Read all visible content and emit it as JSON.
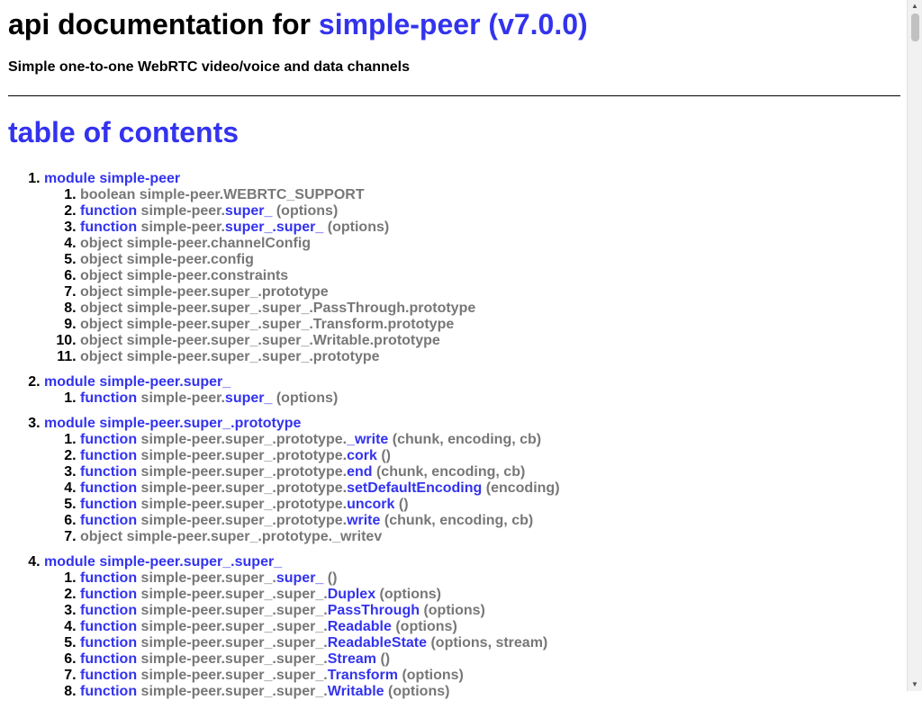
{
  "header": {
    "title_prefix": "api documentation for",
    "project": "simple-peer (v7.0.0)",
    "subtitle": "Simple one-to-one WebRTC video/voice and data channels"
  },
  "toc": {
    "heading": "table of contents",
    "modules": [
      {
        "label": "module simple-peer",
        "members": [
          {
            "kind": "boolean",
            "path": "simple-peer.WEBRTC_SUPPORT",
            "link": "",
            "args": ""
          },
          {
            "kind": "function",
            "path": "simple-peer.",
            "link": "super_",
            "args": "(options)"
          },
          {
            "kind": "function",
            "path": "simple-peer.",
            "link": "super_.super_",
            "args": "(options)"
          },
          {
            "kind": "object",
            "path": "simple-peer.channelConfig",
            "link": "",
            "args": ""
          },
          {
            "kind": "object",
            "path": "simple-peer.config",
            "link": "",
            "args": ""
          },
          {
            "kind": "object",
            "path": "simple-peer.constraints",
            "link": "",
            "args": ""
          },
          {
            "kind": "object",
            "path": "simple-peer.super_.prototype",
            "link": "",
            "args": ""
          },
          {
            "kind": "object",
            "path": "simple-peer.super_.super_.PassThrough.prototype",
            "link": "",
            "args": ""
          },
          {
            "kind": "object",
            "path": "simple-peer.super_.super_.Transform.prototype",
            "link": "",
            "args": ""
          },
          {
            "kind": "object",
            "path": "simple-peer.super_.super_.Writable.prototype",
            "link": "",
            "args": ""
          },
          {
            "kind": "object",
            "path": "simple-peer.super_.super_.prototype",
            "link": "",
            "args": ""
          }
        ]
      },
      {
        "label": "module simple-peer.super_",
        "members": [
          {
            "kind": "function",
            "path": "simple-peer.",
            "link": "super_",
            "args": "(options)"
          }
        ]
      },
      {
        "label": "module simple-peer.super_.prototype",
        "members": [
          {
            "kind": "function",
            "path": "simple-peer.super_.prototype.",
            "link": "_write",
            "args": "(chunk, encoding, cb)"
          },
          {
            "kind": "function",
            "path": "simple-peer.super_.prototype.",
            "link": "cork",
            "args": "()"
          },
          {
            "kind": "function",
            "path": "simple-peer.super_.prototype.",
            "link": "end",
            "args": "(chunk, encoding, cb)"
          },
          {
            "kind": "function",
            "path": "simple-peer.super_.prototype.",
            "link": "setDefaultEncoding",
            "args": "(encoding)"
          },
          {
            "kind": "function",
            "path": "simple-peer.super_.prototype.",
            "link": "uncork",
            "args": "()"
          },
          {
            "kind": "function",
            "path": "simple-peer.super_.prototype.",
            "link": "write",
            "args": "(chunk, encoding, cb)"
          },
          {
            "kind": "object",
            "path": "simple-peer.super_.prototype._writev",
            "link": "",
            "args": ""
          }
        ]
      },
      {
        "label": "module simple-peer.super_.super_",
        "members": [
          {
            "kind": "function",
            "path": "simple-peer.super_.",
            "link": "super_",
            "args": "()"
          },
          {
            "kind": "function",
            "path": "simple-peer.super_.super_.",
            "link": "Duplex",
            "args": "(options)"
          },
          {
            "kind": "function",
            "path": "simple-peer.super_.super_.",
            "link": "PassThrough",
            "args": "(options)"
          },
          {
            "kind": "function",
            "path": "simple-peer.super_.super_.",
            "link": "Readable",
            "args": "(options)"
          },
          {
            "kind": "function",
            "path": "simple-peer.super_.super_.",
            "link": "ReadableState",
            "args": "(options, stream)"
          },
          {
            "kind": "function",
            "path": "simple-peer.super_.super_.",
            "link": "Stream",
            "args": "()"
          },
          {
            "kind": "function",
            "path": "simple-peer.super_.super_.",
            "link": "Transform",
            "args": "(options)"
          },
          {
            "kind": "function",
            "path": "simple-peer.super_.super_.",
            "link": "Writable",
            "args": "(options)"
          }
        ]
      }
    ]
  },
  "scrollbar": {
    "up_icon": "triangle-up-icon",
    "down_icon": "triangle-down-icon"
  }
}
